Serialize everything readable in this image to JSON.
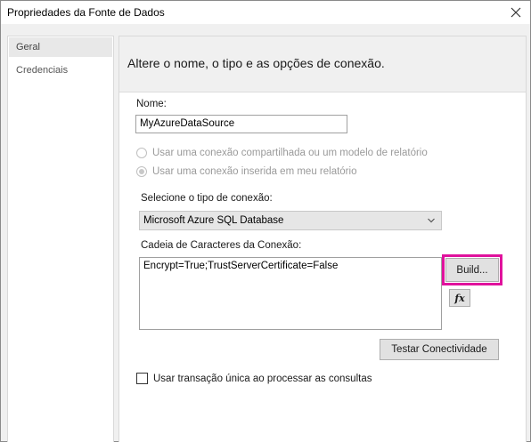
{
  "window": {
    "title": "Propriedades da Fonte de Dados"
  },
  "nav": {
    "items": [
      {
        "label": "Geral",
        "selected": true
      },
      {
        "label": "Credenciais",
        "selected": false
      }
    ]
  },
  "content": {
    "header": "Altere o nome, o tipo e as opções de conexão.",
    "name_label": "Nome:",
    "name_value": "MyAzureDataSource",
    "radio_shared": {
      "label": "Usar uma conexão compartilhada ou um modelo de relatório",
      "checked": false,
      "enabled": false
    },
    "radio_embedded": {
      "label": "Usar uma conexão inserida em meu relatório",
      "checked": true,
      "enabled": false
    },
    "connection_type_label": "Selecione o tipo de conexão:",
    "connection_type_value": "Microsoft Azure SQL Database",
    "connection_string_label": "Cadeia de Caracteres da Conexão:",
    "connection_string_value": "Encrypt=True;TrustServerCertificate=False",
    "build_button": "Build...",
    "expression_button_icon": "fx-icon",
    "test_connection_button": "Testar Conectividade",
    "single_transaction_label": "Usar transação única ao processar as consultas",
    "single_transaction_checked": false
  },
  "colors": {
    "highlight": "#e0129d",
    "panel_bg": "#f0f0f0"
  }
}
